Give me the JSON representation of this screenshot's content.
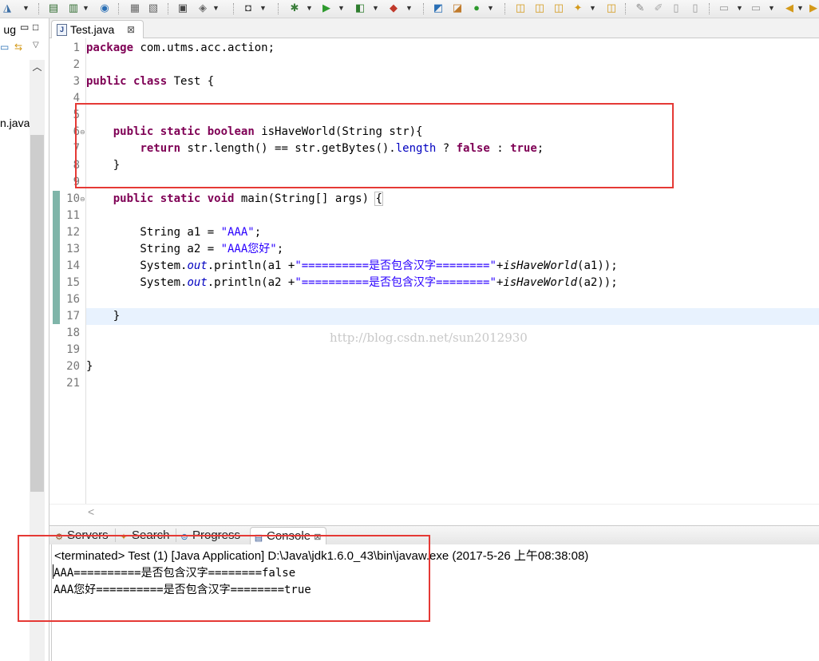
{
  "toolbar": {
    "icons": [
      "debug-perspective-icon",
      "new-server-icon",
      "new-file-icon",
      "globe-icon",
      "open-type-icon",
      "open-resource-icon",
      "build-icon",
      "properties-icon",
      "camera-icon",
      "debug-icon",
      "run-icon",
      "coverage-icon",
      "external-tools-icon",
      "new-java-project-icon",
      "new-package-icon",
      "new-class-icon",
      "open-folder-icon",
      "search-icon",
      "task-icon",
      "pin-icon",
      "annotation-icon",
      "back-icon",
      "forward-icon"
    ]
  },
  "left_view": {
    "tab_label": "ug",
    "visible_item": "n.java",
    "minimize": "▭",
    "maximize": "□"
  },
  "editor": {
    "tab_label": "Test.java",
    "tab_close": "⊠",
    "line_numbers": [
      "1",
      "2",
      "3",
      "4",
      "5",
      "6",
      "7",
      "8",
      "9",
      "10",
      "11",
      "12",
      "13",
      "14",
      "15",
      "16",
      "17",
      "18",
      "19",
      "20",
      "21"
    ],
    "code": {
      "l1_kw": "package",
      "l1_rest": " com.utms.acc.action;",
      "l3_kw1": "public",
      "l3_kw2": "class",
      "l3_rest": " Test {",
      "l6_indent": "    ",
      "l6_kw1": "public",
      "l6_kw2": "static",
      "l6_kw3": "boolean",
      "l6_rest": " isHaveWorld(String str){",
      "l7_indent": "        ",
      "l7_kw": "return",
      "l7_mid": " str.length() == str.getBytes().",
      "l7_field": "length",
      "l7_q": " ? ",
      "l7_false": "false",
      "l7_colon": " : ",
      "l7_true": "true",
      "l7_end": ";",
      "l8": "    }",
      "l10_indent": "    ",
      "l10_kw1": "public",
      "l10_kw2": "static",
      "l10_kw3": "void",
      "l10_rest": " main(String[] args) ",
      "l10_brace": "{",
      "l12_pre": "        String a1 = ",
      "l12_str": "\"AAA\"",
      "l12_end": ";",
      "l13_pre": "        String a2 = ",
      "l13_str": "\"AAA您好\"",
      "l13_end": ";",
      "l14_pre": "        System.",
      "l14_out": "out",
      "l14_mid": ".println(a1 +",
      "l14_str": "\"==========是否包含汉字========\"",
      "l14_plus": "+",
      "l14_call": "isHaveWorld",
      "l14_end": "(a1));",
      "l15_pre": "        System.",
      "l15_out": "out",
      "l15_mid": ".println(a2 +",
      "l15_str": "\"==========是否包含汉字========\"",
      "l15_plus": "+",
      "l15_call": "isHaveWorld",
      "l15_end": "(a2));",
      "l17": "    }",
      "l20": "}"
    },
    "watermark": "http://blog.csdn.net/sun2012930",
    "scroll_left": "<"
  },
  "console": {
    "tabs": [
      "Servers",
      "Search",
      "Progress",
      "Console"
    ],
    "tab_close": "⊠",
    "header": "<terminated> Test (1) [Java Application] D:\\Java\\jdk1.6.0_43\\bin\\javaw.exe (2017-5-26 上午08:38:08)",
    "output": [
      "AAA==========是否包含汉字========false",
      "AAA您好==========是否包含汉字========true"
    ]
  },
  "colors": {
    "keyword": "#7f0055",
    "string": "#2a00ff",
    "field": "#0000c0",
    "annotation_box": "#e53935",
    "current_line": "#e8f2fe"
  }
}
